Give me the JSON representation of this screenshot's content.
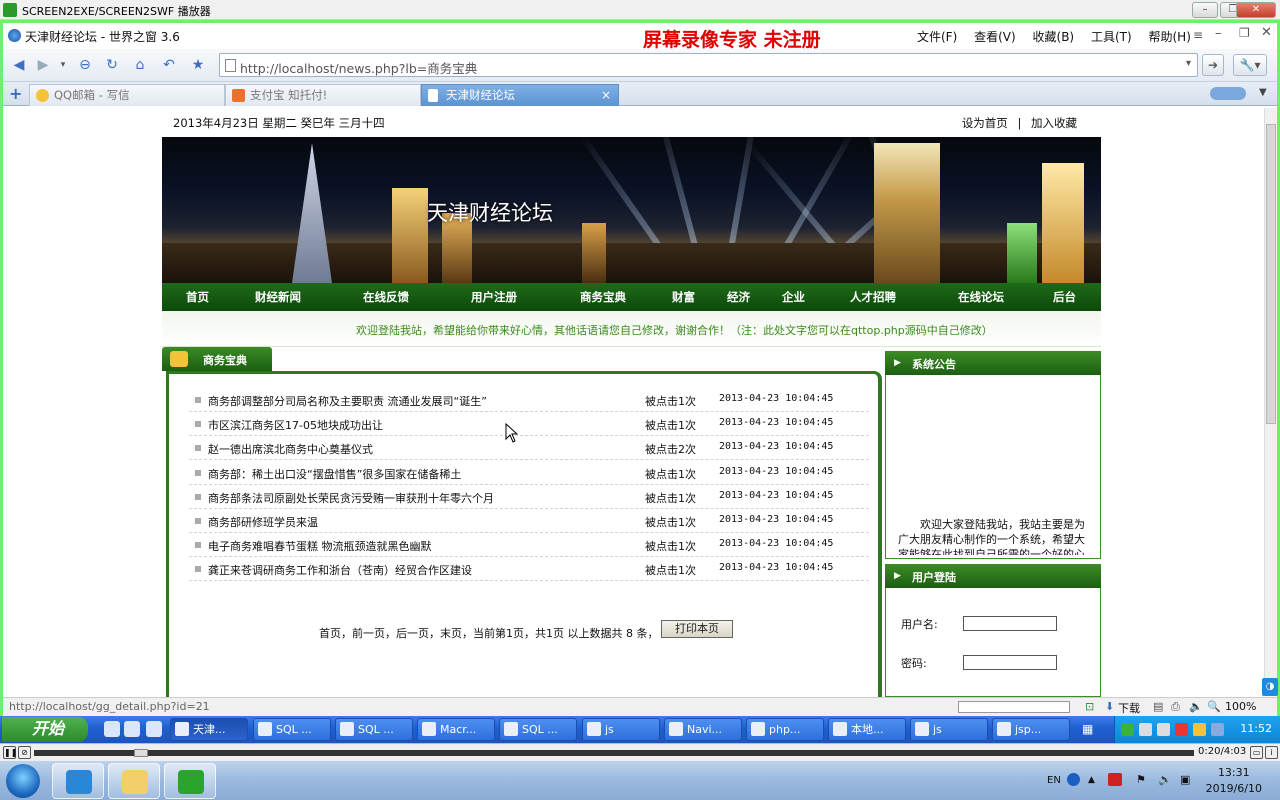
{
  "player": {
    "window_title": "SCREEN2EXE/SCREEN2SWF 播放器",
    "time": "0:20/4:03"
  },
  "browser": {
    "window_title": "天津财经论坛 - 世界之窗 3.6",
    "watermark": "屏幕录像专家  未注册",
    "menu": [
      "文件(F)",
      "查看(V)",
      "收藏(B)",
      "工具(T)",
      "帮助(H)"
    ],
    "address": "http://localhost/news.php?lb=商务宝典",
    "tabs": [
      {
        "label": "QQ邮箱 - 写信",
        "icon": "qq-mail-icon"
      },
      {
        "label": "支付宝 知托付!",
        "icon": "alipay-icon"
      },
      {
        "label": "天津财经论坛",
        "icon": "page-icon",
        "close": "×"
      }
    ],
    "status_url": "http://localhost/gg_detail.php?id=21",
    "download_label": "下载",
    "zoom": "100%"
  },
  "page": {
    "date": "2013年4月23日  星期二  癸巳年  三月十四",
    "links": [
      "设为首页",
      "加入收藏"
    ],
    "link_sep": "|",
    "banner_title": "天津财经论坛",
    "nav": [
      "首页",
      "财经新闻",
      "在线反馈",
      "用户注册",
      "商务宝典",
      "财富",
      "经济",
      "企业",
      "人才招聘",
      "在线论坛",
      "后台"
    ],
    "welcome": "欢迎登陆我站，希望能给你带来好心情，其他话语请您自己修改，谢谢合作！（注：此处文字您可以在qttop.php源码中自己修改）",
    "section_title": "商务宝典",
    "articles": [
      {
        "title": "商务部调整部分司局名称及主要职责 流通业发展司“诞生”",
        "clicks": "被点击1次",
        "date": "2013-04-23 10:04:45"
      },
      {
        "title": "市区滨江商务区17-05地块成功出让",
        "clicks": "被点击1次",
        "date": "2013-04-23 10:04:45"
      },
      {
        "title": "赵一德出席滨北商务中心奠基仪式",
        "clicks": "被点击2次",
        "date": "2013-04-23 10:04:45"
      },
      {
        "title": "商务部：稀土出口没“摆盘惜售”很多国家在储备稀土",
        "clicks": "被点击1次",
        "date": "2013-04-23 10:04:45"
      },
      {
        "title": "商务部条法司原副处长荣民贪污受贿一审获刑十年零六个月",
        "clicks": "被点击1次",
        "date": "2013-04-23 10:04:45"
      },
      {
        "title": "商务部研修班学员来温",
        "clicks": "被点击1次",
        "date": "2013-04-23 10:04:45"
      },
      {
        "title": "电子商务难唱春节蛋糕 物流瓶颈造就黑色幽默",
        "clicks": "被点击1次",
        "date": "2013-04-23 10:04:45"
      },
      {
        "title": "龚正来苍调研商务工作和浙台（苍南）经贸合作区建设",
        "clicks": "被点击1次",
        "date": "2013-04-23 10:04:45"
      }
    ],
    "pager": "首页，前一页，后一页，末页，当前第1页，共1页 以上数据共 8 条，",
    "print_button": "打印本页",
    "notice_title": "系统公告",
    "notice_text": "欢迎大家登陆我站，我站主要是为广大朋友精心制作的一个系统，希望大家能够在此找到自己所需的一个好的心情",
    "login_title": "用户登陆",
    "username_label": "用户名:",
    "password_label": "密码:"
  },
  "xp_taskbar": {
    "start": "开始",
    "tasks": [
      "天津...",
      "SQL ...",
      "SQL ...",
      "Macr...",
      "SQL ...",
      "js",
      "Navi...",
      "php...",
      "本地...",
      "js",
      "jsp..."
    ],
    "clock": "11:52"
  },
  "win7_taskbar": {
    "lang": "EN",
    "time": "13:31",
    "date": "2019/6/10"
  },
  "colors": {
    "frame_green": "#6ef06e",
    "nav_green": "#1a5f14",
    "watermark_red": "#e00000"
  }
}
